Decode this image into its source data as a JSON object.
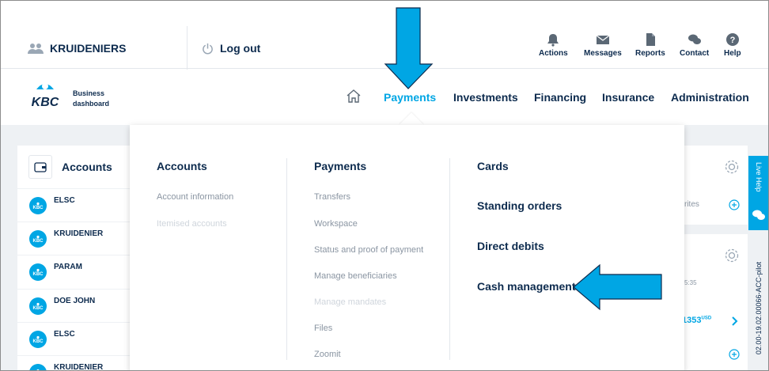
{
  "header": {
    "user_name": "KRUIDENIERS",
    "logout_label": "Log out",
    "quick_actions": [
      {
        "label": "Actions",
        "icon": "bell-icon"
      },
      {
        "label": "Messages",
        "icon": "envelope-icon"
      },
      {
        "label": "Reports",
        "icon": "document-icon"
      },
      {
        "label": "Contact",
        "icon": "chat-icon"
      },
      {
        "label": "Help",
        "icon": "help-icon"
      }
    ]
  },
  "brand": {
    "line1": "Business",
    "line2": "dashboard",
    "color": "#0d2b4e",
    "accent": "#00a6e4"
  },
  "nav": {
    "items": [
      "Payments",
      "Investments",
      "Financing",
      "Insurance",
      "Administration"
    ],
    "active": "Payments"
  },
  "accounts_panel": {
    "title": "Accounts",
    "rows": [
      "ELSC",
      "KRUIDENIER",
      "PARAM",
      "DOE JOHN",
      "ELSC",
      "KRUIDENIER"
    ]
  },
  "mega_menu": {
    "col1": {
      "heading": "Accounts",
      "items": [
        {
          "label": "Account information",
          "disabled": false
        },
        {
          "label": "Itemised accounts",
          "disabled": true
        }
      ]
    },
    "col2": {
      "heading": "Payments",
      "items": [
        {
          "label": "Transfers",
          "disabled": false
        },
        {
          "label": "Workspace",
          "disabled": false
        },
        {
          "label": "Status and proof of payment",
          "disabled": false
        },
        {
          "label": "Manage beneficiaries",
          "disabled": false
        },
        {
          "label": "Manage mandates",
          "disabled": true
        },
        {
          "label": "Files",
          "disabled": false
        },
        {
          "label": "Zoomit",
          "disabled": false
        }
      ]
    },
    "col3": {
      "items": [
        "Cards",
        "Standing orders",
        "Direct debits",
        "Cash management"
      ]
    }
  },
  "right_panel": {
    "partial_text": "rites",
    "time_text": "5:35",
    "amount": ",1353",
    "currency": "USD"
  },
  "live_help": {
    "label": "Live Help"
  },
  "build_tag": "02.00-19.02.00066-ACC-pilot"
}
